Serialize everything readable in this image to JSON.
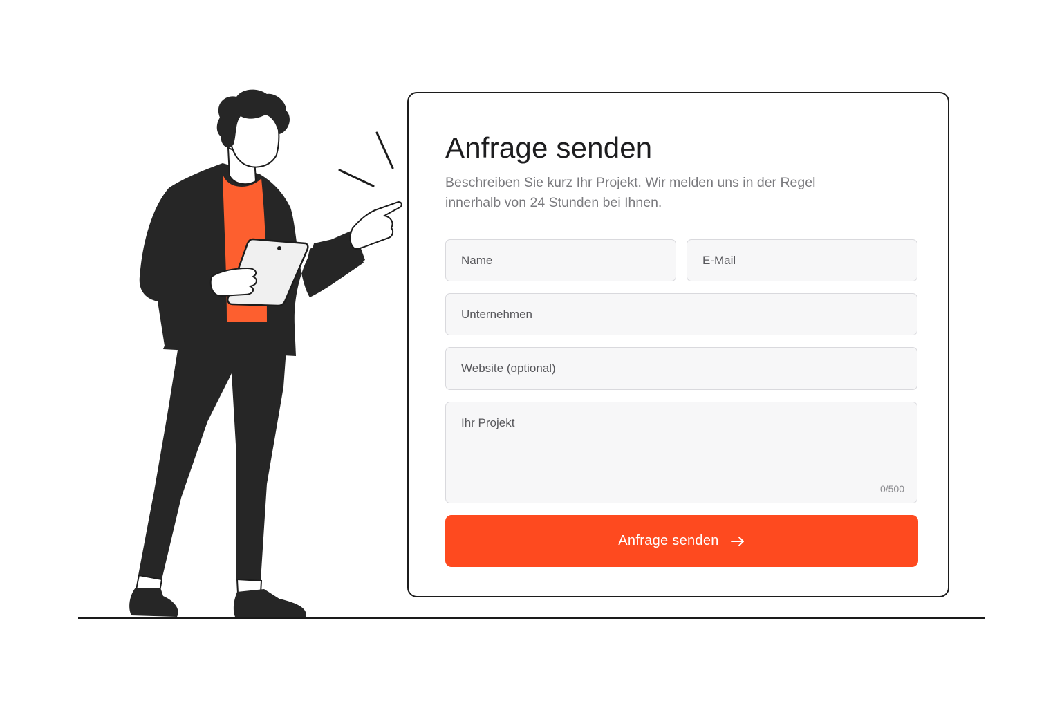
{
  "form": {
    "title": "Anfrage senden",
    "description": "Beschreiben Sie kurz Ihr Projekt. Wir melden uns in der Regel innerhalb von 24 Stunden bei Ihnen.",
    "fields": {
      "name": "Name",
      "email": "E-Mail",
      "company": "Unternehmen",
      "website": "Website (optional)",
      "project": "Ihr Projekt"
    },
    "project_char_count": "0/500",
    "submit_label": "Anfrage senden",
    "submit_icon": "arrow-right-icon"
  },
  "colors": {
    "accent": "#fe4a1f",
    "shirt": "#fd5f2f",
    "outline": "#1c1c1c",
    "field_bg": "#f7f7f8"
  },
  "illustration": {
    "subject": "person-with-tablet-pointing"
  }
}
